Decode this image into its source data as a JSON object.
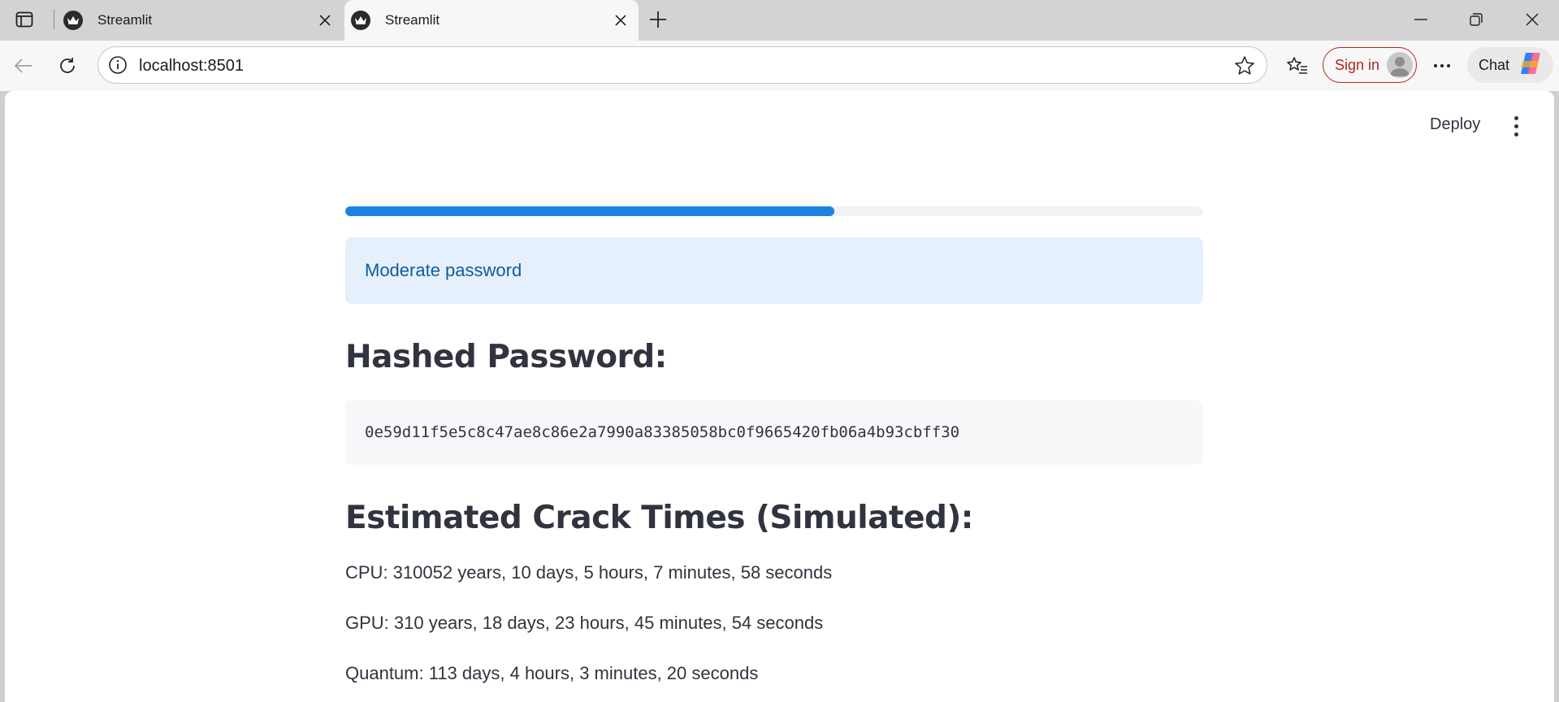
{
  "browser": {
    "tabs": [
      {
        "title": "Streamlit",
        "active": false
      },
      {
        "title": "Streamlit",
        "active": true
      }
    ],
    "url": "localhost:8501",
    "signin_label": "Sign in",
    "chat_label": "Chat"
  },
  "app": {
    "deploy_label": "Deploy",
    "progress_percent": 57,
    "strength_message": "Moderate password",
    "hashed_heading": "Hashed Password:",
    "hash_value": "0e59d11f5e5c8c47ae8c86e2a7990a83385058bc0f9665420fb06a4b93cbff30",
    "crack_heading": "Estimated Crack Times (Simulated):",
    "crack_times": {
      "cpu": "CPU: 310052 years, 10 days, 5 hours, 7 minutes, 58 seconds",
      "gpu": "GPU: 310 years, 18 days, 23 hours, 45 minutes, 54 seconds",
      "quantum": "Quantum: 113 days, 4 hours, 3 minutes, 20 seconds"
    }
  },
  "colors": {
    "accent": "#1c83e1",
    "info_bg": "#e6f0fc",
    "info_text": "#0f5c9c",
    "signin": "#b3261e"
  }
}
